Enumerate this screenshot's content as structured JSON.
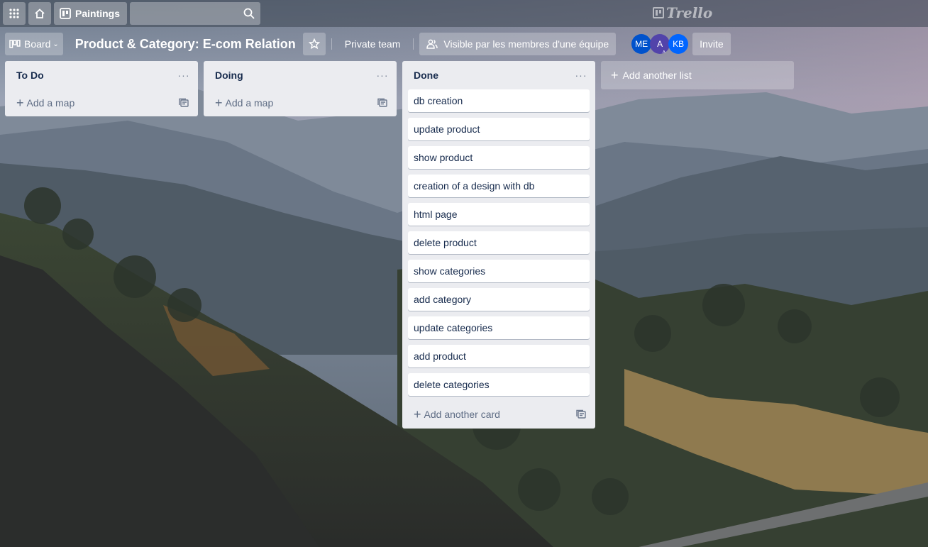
{
  "topbar": {
    "boards_label": "Paintings",
    "search_placeholder": "",
    "logo_text": "Trello"
  },
  "board": {
    "view_label": "Board",
    "title": "Product & Category: E-com Relation",
    "team_label": "Private team",
    "visibility_label": "Visible par les membres d'une équipe",
    "invite_label": "Invite",
    "members": [
      {
        "initials": "ME",
        "color": "#0052cc"
      },
      {
        "initials": "A",
        "color": "#5243aa"
      },
      {
        "initials": "KB",
        "color": "#0065ff"
      }
    ]
  },
  "lists": [
    {
      "title": "To Do",
      "cards": [],
      "add_label": "Add a map"
    },
    {
      "title": "Doing",
      "cards": [],
      "add_label": "Add a map"
    },
    {
      "title": "Done",
      "cards": [
        "db creation",
        "update product",
        "show product",
        "creation of a design with db",
        "html page",
        "delete product",
        "show categories",
        "add category",
        "update categories",
        "add product",
        "delete categories"
      ],
      "add_label": "Add another card"
    }
  ],
  "add_list_label": "Add another list",
  "colors": {
    "list_bg": "#ebecf0",
    "card_bg": "#ffffff",
    "text": "#172b4d",
    "muted": "#5e6c84"
  }
}
